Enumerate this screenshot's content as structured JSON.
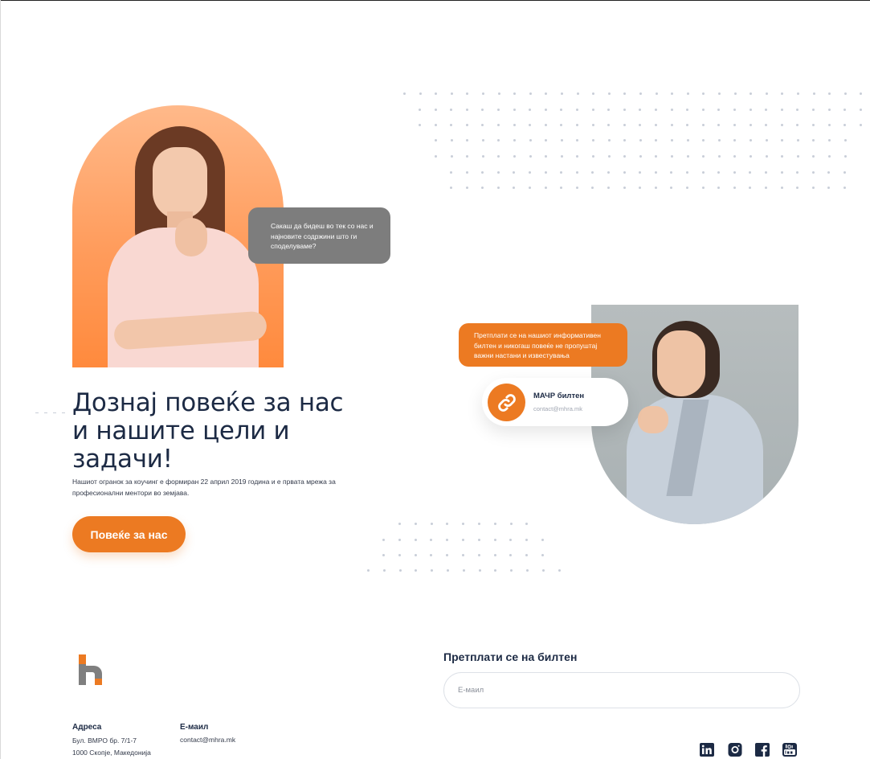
{
  "hero": {
    "bubble_grey": "Сакаш да бидеш во тек со нас и најновите содржини што ги споделуваме?",
    "heading": "Дознај повеќе за нас и нашите цели и задачи!",
    "paragraph": "Нашиот огранок за коучинг е формиран 22 април 2019 година и е првата мрежа за професионални ментори во земјава.",
    "button_label": "Повеќе за нас"
  },
  "subscribe_card": {
    "bubble_orange": "Претплати се на нашиот информативен билтен и никогаш повеќе не пропуштај важни настани и известувања",
    "title": "МАЧР билтен",
    "subtitle": "contact@mhra.mk",
    "icon": "link-icon"
  },
  "footer": {
    "address_label": "Адреса",
    "address_line1": "Бул. ВМРО бр. 7/1-7",
    "address_line2": "1000 Скопје, Македонија",
    "email_label": "Е-маил",
    "email_value": "contact@mhra.mk",
    "newsletter_title": "Претплати се на билтен",
    "newsletter_placeholder": "Е-маил",
    "social": [
      "linkedin-icon",
      "instagram-icon",
      "facebook-icon",
      "youtube-icon"
    ]
  },
  "colors": {
    "accent": "#ec7a22",
    "dark_text": "#1c2a44",
    "bubble_grey": "#7d7d7d",
    "logo_grey": "#7f7f7f"
  }
}
